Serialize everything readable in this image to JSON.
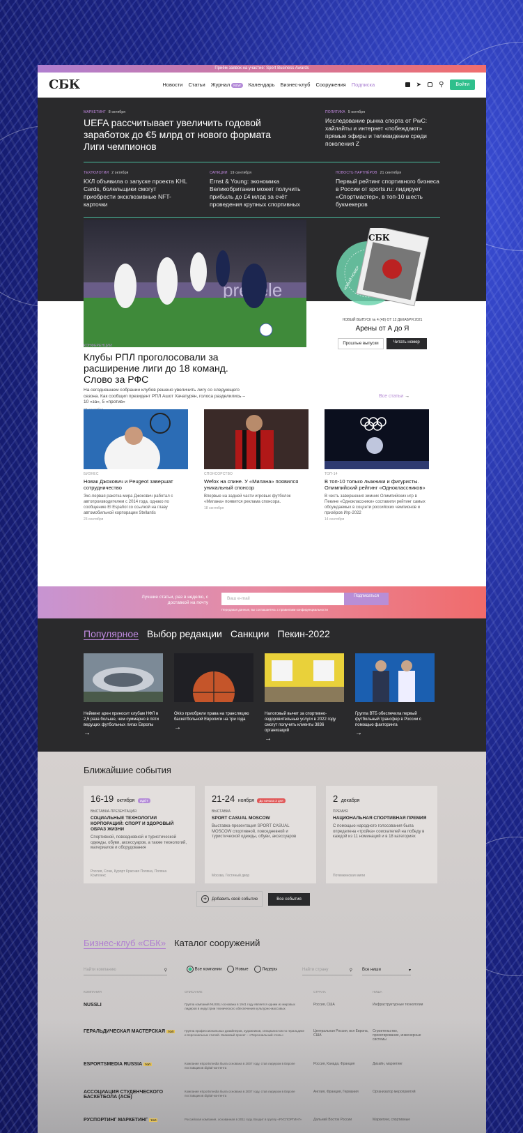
{
  "promo_bar": "Приём заявок на участие: Sport Business Awards",
  "header": {
    "logo": "СБК",
    "nav": [
      "Новости",
      "Статьи",
      "Журнал",
      "Календарь",
      "Бизнес-клуб",
      "Сооружения",
      "Подписка"
    ],
    "new_badge": "NEW",
    "login": "Войти"
  },
  "top_news": {
    "lead": {
      "tag": "Маркетинг",
      "date": "8 октября",
      "title": "UEFA рассчитывает увеличить годовой заработок до €5 млрд от нового формата Лиги чемпионов"
    },
    "side": {
      "tag": "Политика",
      "date": "5 октября",
      "title": "Исследование рынка спорта от PwC: хайлайты и интернет «побеждают» прямые эфиры и телевидение среди поколения Z"
    },
    "row": [
      {
        "tag": "Технологии",
        "date": "2 октября",
        "title": "КХЛ объявила о запуске проекта KHL Cards, болельщики смогут приобрести эксклюзивные NFT-карточки"
      },
      {
        "tag": "Санкции",
        "date": "19 сентября",
        "title": "Ernst & Young: экономика Великобритании может получить прибыль до £4 млрд за счёт проведения крупных спортивных"
      },
      {
        "tag": "Новость партнёров",
        "date": "21 сентября",
        "title": "Первый рейтинг спортивного бизнеса в России от sports.ru: лидирует «Спортмастер», в топ-10 шесть букмекеров"
      }
    ]
  },
  "hero": {
    "tag": "Конференции",
    "title": "Клубы РПЛ проголосовали за расширение лиги до 18 команд. Слово за РФС",
    "lead": "На сегодняшнем собрании клубов решено увеличить лигу со следующего сезона. Как сообщил президент РПЛ Ашот Хачатурян, голоса разделились – 10 «за», 5 «против»",
    "date": "23 сентября"
  },
  "magazine": {
    "badge": "НОВЫЙ НОМЕР",
    "cover_logo": "СБК",
    "issue": "НОВЫЙ ВЫПУСК № 4 (48) ОТ 12 ДЕКАБРЯ 2021",
    "title": "Арены от А до Я",
    "btn_past": "Прошлые выпуски",
    "btn_read": "Читать номер"
  },
  "all_articles": "Все статьи",
  "articles": [
    {
      "tag": "Бизнес",
      "title": "Новак Джокович и Peugeot завершат сотрудничество",
      "lead": "Экс-первая ракетка мира Джокович работал с автопроизводителем с 2014 года, однако по сообщению El Español со ссылкой на главу автомобильной корпорации Stellantis",
      "date": "23 сентября"
    },
    {
      "tag": "Спонсорство",
      "title": "Wefox на спине. У «Милана» появился уникальный спонсор",
      "lead": "Впервые на задней части игровых футболок «Милана» появится реклама спонсора.",
      "date": "18 сентября"
    },
    {
      "tag": "Топ-14",
      "title": "В топ-10 только лыжники и фигуристы. Олимпийский рейтинг «Одноклассников»",
      "lead": "В честь завершения зимних Олимпийских игр в Пекине «Одноклассники» составили рейтинг самых обсуждаемых в соцсети российских чемпионов и призёров Игр-2022",
      "date": "14 сентября"
    }
  ],
  "subscribe": {
    "text": "Лучшие статьи, раз в неделю, с доставкой на почту",
    "placeholder": "Ваш e-mail",
    "button": "Подписаться",
    "consent": "Передавая данные, вы соглашаетесь с правилами конфиденциальности"
  },
  "popular": {
    "tabs": [
      "Популярное",
      "Выбор редакции",
      "Санкции",
      "Пекин-2022"
    ],
    "items": [
      {
        "title": "Нейминг арен приносит клубам НФЛ в 2,5 раза больше, чем суммарно в пяти ведущих футбольных лигах Европы"
      },
      {
        "title": "Okko приобрели права на трансляцию баскетбольной Евролиги на три года"
      },
      {
        "title": "Налоговый вычет за спортивно-оздоровительные услуги в 2022 году смогут получить клиенты 3836 организаций"
      },
      {
        "title": "Группа ВТБ обеспечила первый футбольный трансфер в России с помощью факторинга"
      }
    ]
  },
  "events": {
    "title": "Ближайшие события",
    "cards": [
      {
        "days": "16-19",
        "month": "октября",
        "badge": "ИДЁТ",
        "type": "Выставка-презентация",
        "name": "СОЦИАЛЬНЫЕ ТЕХНОЛОГИИ КОРПОРАЦИЙ: СПОРТ И ЗДОРОВЫЙ ОБРАЗ ЖИЗНИ",
        "desc": "Спортивной, повседневной и туристической одежды, обуви, аксессуаров, а также технологий, материалов и оборудования",
        "place": "Россия, Сочи, Курорт Красная Поляна, Поляна Комплекс"
      },
      {
        "days": "21-24",
        "month": "ноября",
        "badge": "До начала 3 дня",
        "type": "Выставка",
        "name": "SPORT CASUAL MOSCOW",
        "desc": "Выставка-презентация SPORT CASUAL MOSCOW спортивной, повседневной и туристической одежды, обуви, аксессуаров",
        "place": "Москва, Гостиный двор"
      },
      {
        "days": "2",
        "month": "декабря",
        "badge": "",
        "type": "Премия",
        "name": "НАЦИОНАЛЬНАЯ СПОРТИВНАЯ ПРЕМИЯ",
        "desc": "С помощью народного голосования была определена «тройка» соискателей на победу в каждой из 11 номинаций и в 18 категориях",
        "place": "Потемкинская мили"
      }
    ],
    "add": "Добавить своё событие",
    "all": "Все события"
  },
  "club": {
    "tabs": [
      "Бизнес-клуб «СБК»",
      "Каталог сооружений"
    ],
    "search_placeholder": "Найти компанию",
    "filters": [
      "Все компании",
      "Новые",
      "Лидеры"
    ],
    "country_placeholder": "Найти страну",
    "niche": "Все ниши",
    "columns": [
      "Компания",
      "Описание",
      "Страна",
      "Ниша"
    ],
    "rows": [
      {
        "name": "NUSSLI",
        "pro": "",
        "desc": "Группа компаний NUSSLI основана в 1941 году является одним из мировых лидеров в индустрии технического обеспечения культурно-массовых",
        "country": "Россия, США",
        "niche": "Инфраструктурные технологии"
      },
      {
        "name": "ГЕРАЛЬДИЧЕСКАЯ МАСТЕРСКАЯ",
        "pro": "ТОП",
        "desc": "Группа профессиональных дизайнеров, художников, специалистов по геральдике и персональных стилей. Знаковый проект – «Персональный стиль»",
        "country": "Центральная Россия, вся Европа, США",
        "niche": "Строительство, проектирование, инженерные системы"
      },
      {
        "name": "ESPORTSMEDIA RUSSIA",
        "pro": "ТОП",
        "desc": "Компания eSportsmedia была основана в 2007 году, став лидером в Европе поставщиков digital-контента",
        "country": "Россия, Канада, Франция",
        "niche": "Дизайн, маркетинг"
      },
      {
        "name": "АССОЦИАЦИЯ СТУДЕНЧЕСКОГО БАСКЕТБОЛА (АСБ)",
        "pro": "",
        "desc": "Компания eSportsmedia была основана в 2007 году, став лидером в Европе поставщиков digital-контента",
        "country": "Англия, Франция, Германия",
        "niche": "Организатор мероприятий"
      },
      {
        "name": "РУСПОРТИНГ МАРКЕТИНГ",
        "pro": "ТОП",
        "desc": "Российская компания, основанная в 2011 году. Входит в группу «РУСПОРТИНГ»",
        "country": "Дальний Восток России",
        "niche": "Маркетинг, спортивные"
      }
    ]
  }
}
